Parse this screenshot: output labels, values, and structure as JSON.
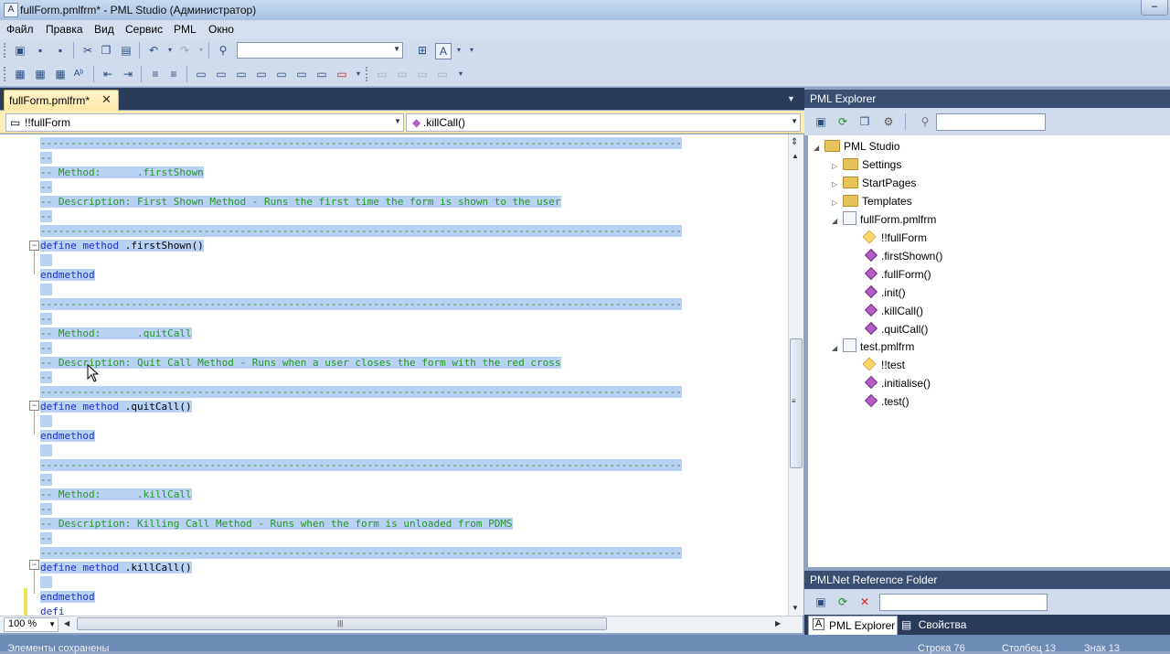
{
  "window": {
    "title": "fullForm.pmlfrm* - PML Studio (Администратор)"
  },
  "menu": [
    "Файл",
    "Правка",
    "Вид",
    "Сервис",
    "PML",
    "Окно"
  ],
  "document_tab": {
    "label": "fullForm.pmlfrm*"
  },
  "nav": {
    "object": "!!fullForm",
    "member": ".killCall()"
  },
  "code": [
    {
      "kind": "c",
      "text": "----------------------------------------------------------------------------------------------------------"
    },
    {
      "kind": "c",
      "text": "--"
    },
    {
      "kind": "c",
      "text": "-- Method:      .firstShown"
    },
    {
      "kind": "c",
      "text": "--"
    },
    {
      "kind": "c",
      "text": "-- Description: First Shown Method - Runs the first time the form is shown to the user"
    },
    {
      "kind": "c",
      "text": "--"
    },
    {
      "kind": "c",
      "text": "----------------------------------------------------------------------------------------------------------"
    },
    {
      "kind": "d",
      "kw": "define method",
      "name": " .firstShown()"
    },
    {
      "kind": "b",
      "text": ""
    },
    {
      "kind": "e",
      "text": "endmethod"
    },
    {
      "kind": "b",
      "text": ""
    },
    {
      "kind": "c",
      "text": "----------------------------------------------------------------------------------------------------------"
    },
    {
      "kind": "c",
      "text": "--"
    },
    {
      "kind": "c",
      "text": "-- Method:      .quitCall"
    },
    {
      "kind": "c",
      "text": "--"
    },
    {
      "kind": "c",
      "text": "-- Description: Quit Call Method - Runs when a user closes the form with the red cross"
    },
    {
      "kind": "c",
      "text": "--"
    },
    {
      "kind": "c",
      "text": "----------------------------------------------------------------------------------------------------------"
    },
    {
      "kind": "d",
      "kw": "define method",
      "name": " .quitCall()"
    },
    {
      "kind": "b",
      "text": ""
    },
    {
      "kind": "e",
      "text": "endmethod"
    },
    {
      "kind": "b",
      "text": ""
    },
    {
      "kind": "c",
      "text": "----------------------------------------------------------------------------------------------------------"
    },
    {
      "kind": "c",
      "text": "--"
    },
    {
      "kind": "c",
      "text": "-- Method:      .killCall"
    },
    {
      "kind": "c",
      "text": "--"
    },
    {
      "kind": "c",
      "text": "-- Description: Killing Call Method - Runs when the form is unloaded from PDMS"
    },
    {
      "kind": "c",
      "text": "--"
    },
    {
      "kind": "c",
      "text": "----------------------------------------------------------------------------------------------------------"
    },
    {
      "kind": "d",
      "kw": "define method",
      "name": " .killCall()"
    },
    {
      "kind": "b",
      "text": ""
    },
    {
      "kind": "e",
      "text": "endmethod"
    },
    {
      "kind": "p",
      "text": "defi"
    }
  ],
  "zoom": "100 %",
  "explorer": {
    "title": "PML Explorer",
    "root": "PML Studio",
    "folders": [
      "Settings",
      "StartPages",
      "Templates"
    ],
    "files": [
      {
        "name": "fullForm.pmlfrm",
        "form": "!!fullForm",
        "methods": [
          ".firstShown()",
          ".fullForm()",
          ".init()",
          ".killCall()",
          ".quitCall()"
        ]
      },
      {
        "name": "test.pmlfrm",
        "form": "!!test",
        "methods": [
          ".initialise()",
          ".test()"
        ]
      }
    ]
  },
  "reference": {
    "title": "PMLNet Reference Folder"
  },
  "bottom_tabs": [
    "PML Explorer",
    "Свойства"
  ],
  "status": {
    "message": "Элементы сохранены",
    "line": "Строка 76",
    "col": "Столбец 13",
    "char": "Знак 13"
  }
}
